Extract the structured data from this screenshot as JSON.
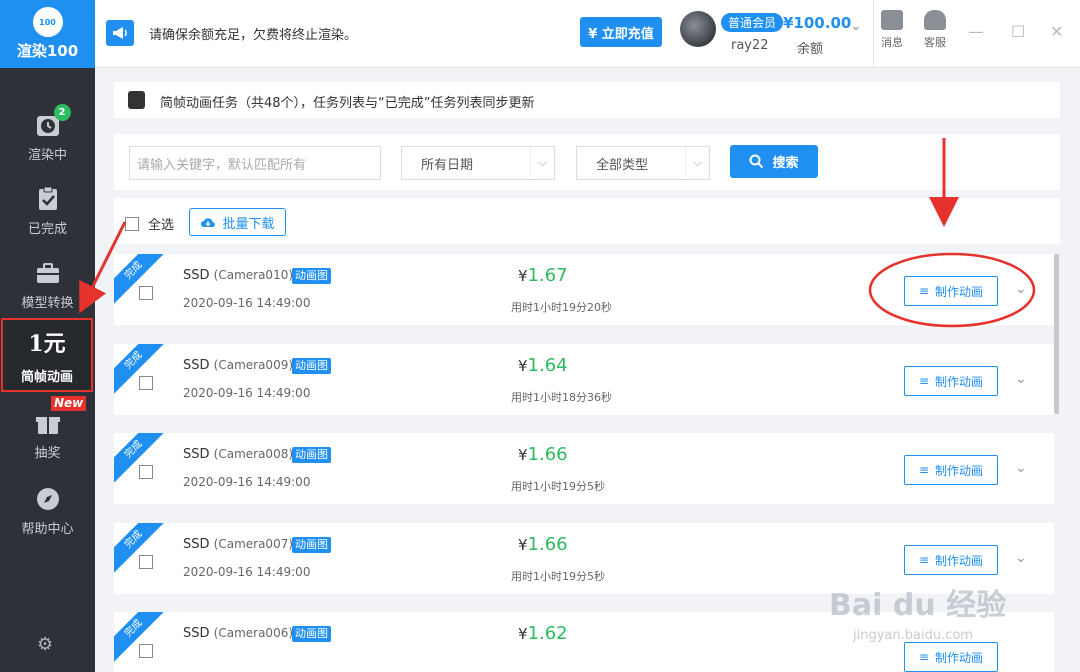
{
  "app": {
    "logo_badge": "100",
    "logo_text": "渲染100"
  },
  "sidebar": {
    "items": [
      {
        "label": "渲染中",
        "badge": "2"
      },
      {
        "label": "已完成"
      },
      {
        "label": "模型转换"
      },
      {
        "label": "简帧动画",
        "big": "1元"
      },
      {
        "label": "抽奖",
        "tag": "New"
      },
      {
        "label": "帮助中心"
      }
    ]
  },
  "topbar": {
    "notice": "请确保余额充足，欠费将终止渲染。",
    "recharge": "¥ 立即充值",
    "member": "普通会员",
    "username": "ray22",
    "balance": "¥100.00",
    "balance_label": "余额",
    "messages": "消息",
    "service": "客服"
  },
  "info": {
    "text": "简帧动画任务（共48个），任务列表与“已完成”任务列表同步更新"
  },
  "filters": {
    "placeholder": "请输入关键字，默认匹配所有",
    "date": "所有日期",
    "type": "全部类型",
    "search": "搜索"
  },
  "toolbar": {
    "select_all": "全选",
    "batch_download": "批量下载"
  },
  "tasks": [
    {
      "status": "完成",
      "name": "SSD",
      "camera": "(Camera010)",
      "tag": "动画图",
      "date": "2020-09-16 14:49:00",
      "yen": "¥",
      "price": "1.67",
      "duration": "用时1小时19分20秒",
      "action": "制作动画"
    },
    {
      "status": "完成",
      "name": "SSD",
      "camera": "(Camera009)",
      "tag": "动画图",
      "date": "2020-09-16 14:49:00",
      "yen": "¥",
      "price": "1.64",
      "duration": "用时1小时18分36秒",
      "action": "制作动画"
    },
    {
      "status": "完成",
      "name": "SSD",
      "camera": "(Camera008)",
      "tag": "动画图",
      "date": "2020-09-16 14:49:00",
      "yen": "¥",
      "price": "1.66",
      "duration": "用时1小时19分5秒",
      "action": "制作动画"
    },
    {
      "status": "完成",
      "name": "SSD",
      "camera": "(Camera007)",
      "tag": "动画图",
      "date": "2020-09-16 14:49:00",
      "yen": "¥",
      "price": "1.66",
      "duration": "用时1小时19分5秒",
      "action": "制作动画"
    },
    {
      "status": "完成",
      "name": "SSD",
      "camera": "(Camera006)",
      "tag": "动画图",
      "date": "",
      "yen": "¥",
      "price": "1.62",
      "duration": "",
      "action": "制作动画"
    }
  ],
  "watermark": {
    "main": "Bai du 经验",
    "sub": "jingyan.baidu.com"
  },
  "colors": {
    "accent": "#1f8ff2",
    "sidebar": "#2e3238",
    "price": "#2dbb5f",
    "annotation": "#e5322d"
  }
}
